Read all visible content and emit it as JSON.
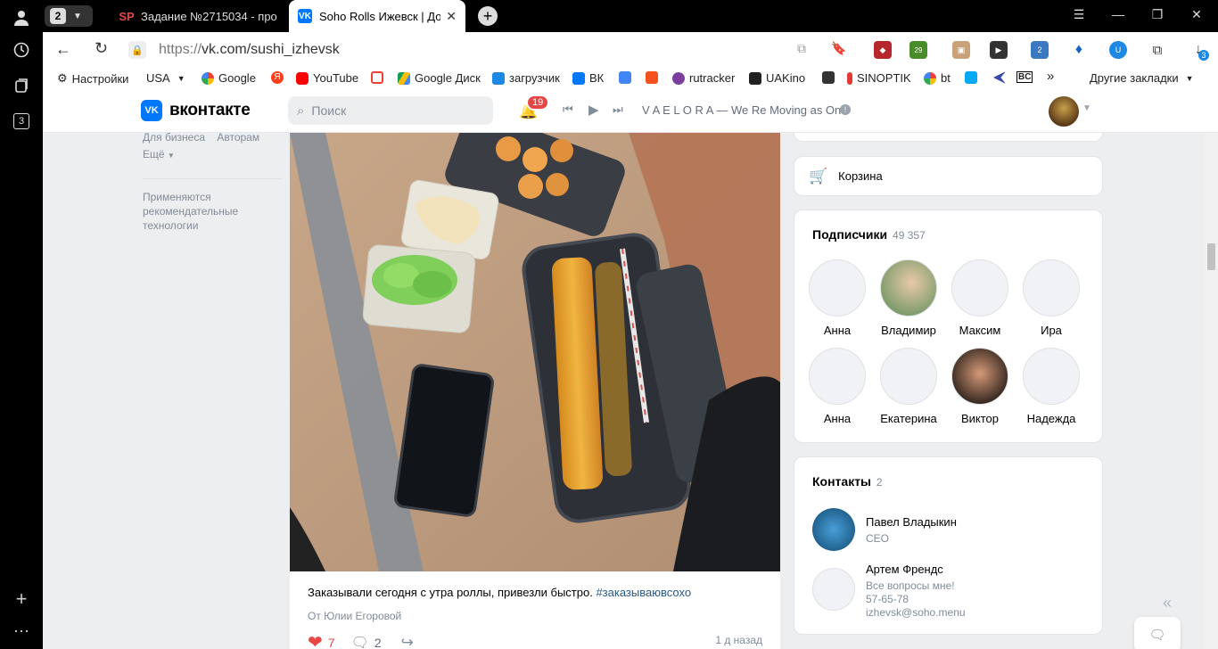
{
  "browser": {
    "tab_count": "2",
    "tabs": [
      {
        "label": "Задание №2715034 - про",
        "favicon": "SP"
      },
      {
        "label": "Soho Rolls Ижевск | Дос",
        "favicon": "VK"
      }
    ],
    "url_scheme": "https://",
    "url_host": "vk.com/sushi_izhevsk",
    "rail_badge": "3",
    "download_badge": "3",
    "ext_badges": {
      "calendar": "29",
      "weather": "2"
    }
  },
  "bookmarks": [
    {
      "label": "Настройки"
    },
    {
      "label": "USA"
    },
    {
      "label": "Google"
    },
    {
      "label": ""
    },
    {
      "label": "YouTube"
    },
    {
      "label": ""
    },
    {
      "label": "Google Диск"
    },
    {
      "label": "загрузчик"
    },
    {
      "label": "ВК"
    },
    {
      "label": ""
    },
    {
      "label": ""
    },
    {
      "label": "rutracker"
    },
    {
      "label": "UAKino"
    },
    {
      "label": ""
    },
    {
      "label": "SINOPTIK"
    },
    {
      "label": "bt"
    },
    {
      "label": ""
    },
    {
      "label": ""
    },
    {
      "label": "BC"
    },
    {
      "label": "»"
    },
    {
      "label": "Другие закладки"
    }
  ],
  "vk": {
    "logo_text": "вконтакте",
    "search_placeholder": "Поиск",
    "notif_count": "19",
    "player_track": "V A E L O R A — We Re Moving as One"
  },
  "left_menu": {
    "business": "Для бизнеса",
    "authors": "Авторам",
    "more": "Ещё",
    "note": "Применяются рекомендательные технологии"
  },
  "post": {
    "text": "Заказывали сегодня с утра роллы, привезли быстро.",
    "hashtag": "#заказываювсохо",
    "author": "От Юлии Егоровой",
    "likes": "7",
    "comments": "2",
    "time": "1 д назад"
  },
  "cart": {
    "label": "Корзина"
  },
  "subscribers": {
    "title": "Подписчики",
    "count": "49 357",
    "people": [
      {
        "name": "Анна"
      },
      {
        "name": "Владимир"
      },
      {
        "name": "Максим"
      },
      {
        "name": "Ира"
      },
      {
        "name": "Анна"
      },
      {
        "name": "Екатерина"
      },
      {
        "name": "Виктор"
      },
      {
        "name": "Надежда"
      }
    ]
  },
  "contacts": {
    "title": "Контакты",
    "count": "2",
    "list": [
      {
        "name": "Павел Владыкин",
        "role": "CEO"
      },
      {
        "name": "Артем Френдс",
        "role": "Все вопросы мне!",
        "phone": "57-65-78",
        "email": "izhevsk@soho.menu"
      }
    ]
  },
  "colors": {
    "vk_blue": "#0077ff",
    "badge_red": "#e64646",
    "link": "#2a5885",
    "page_bg": "#edeef0"
  }
}
